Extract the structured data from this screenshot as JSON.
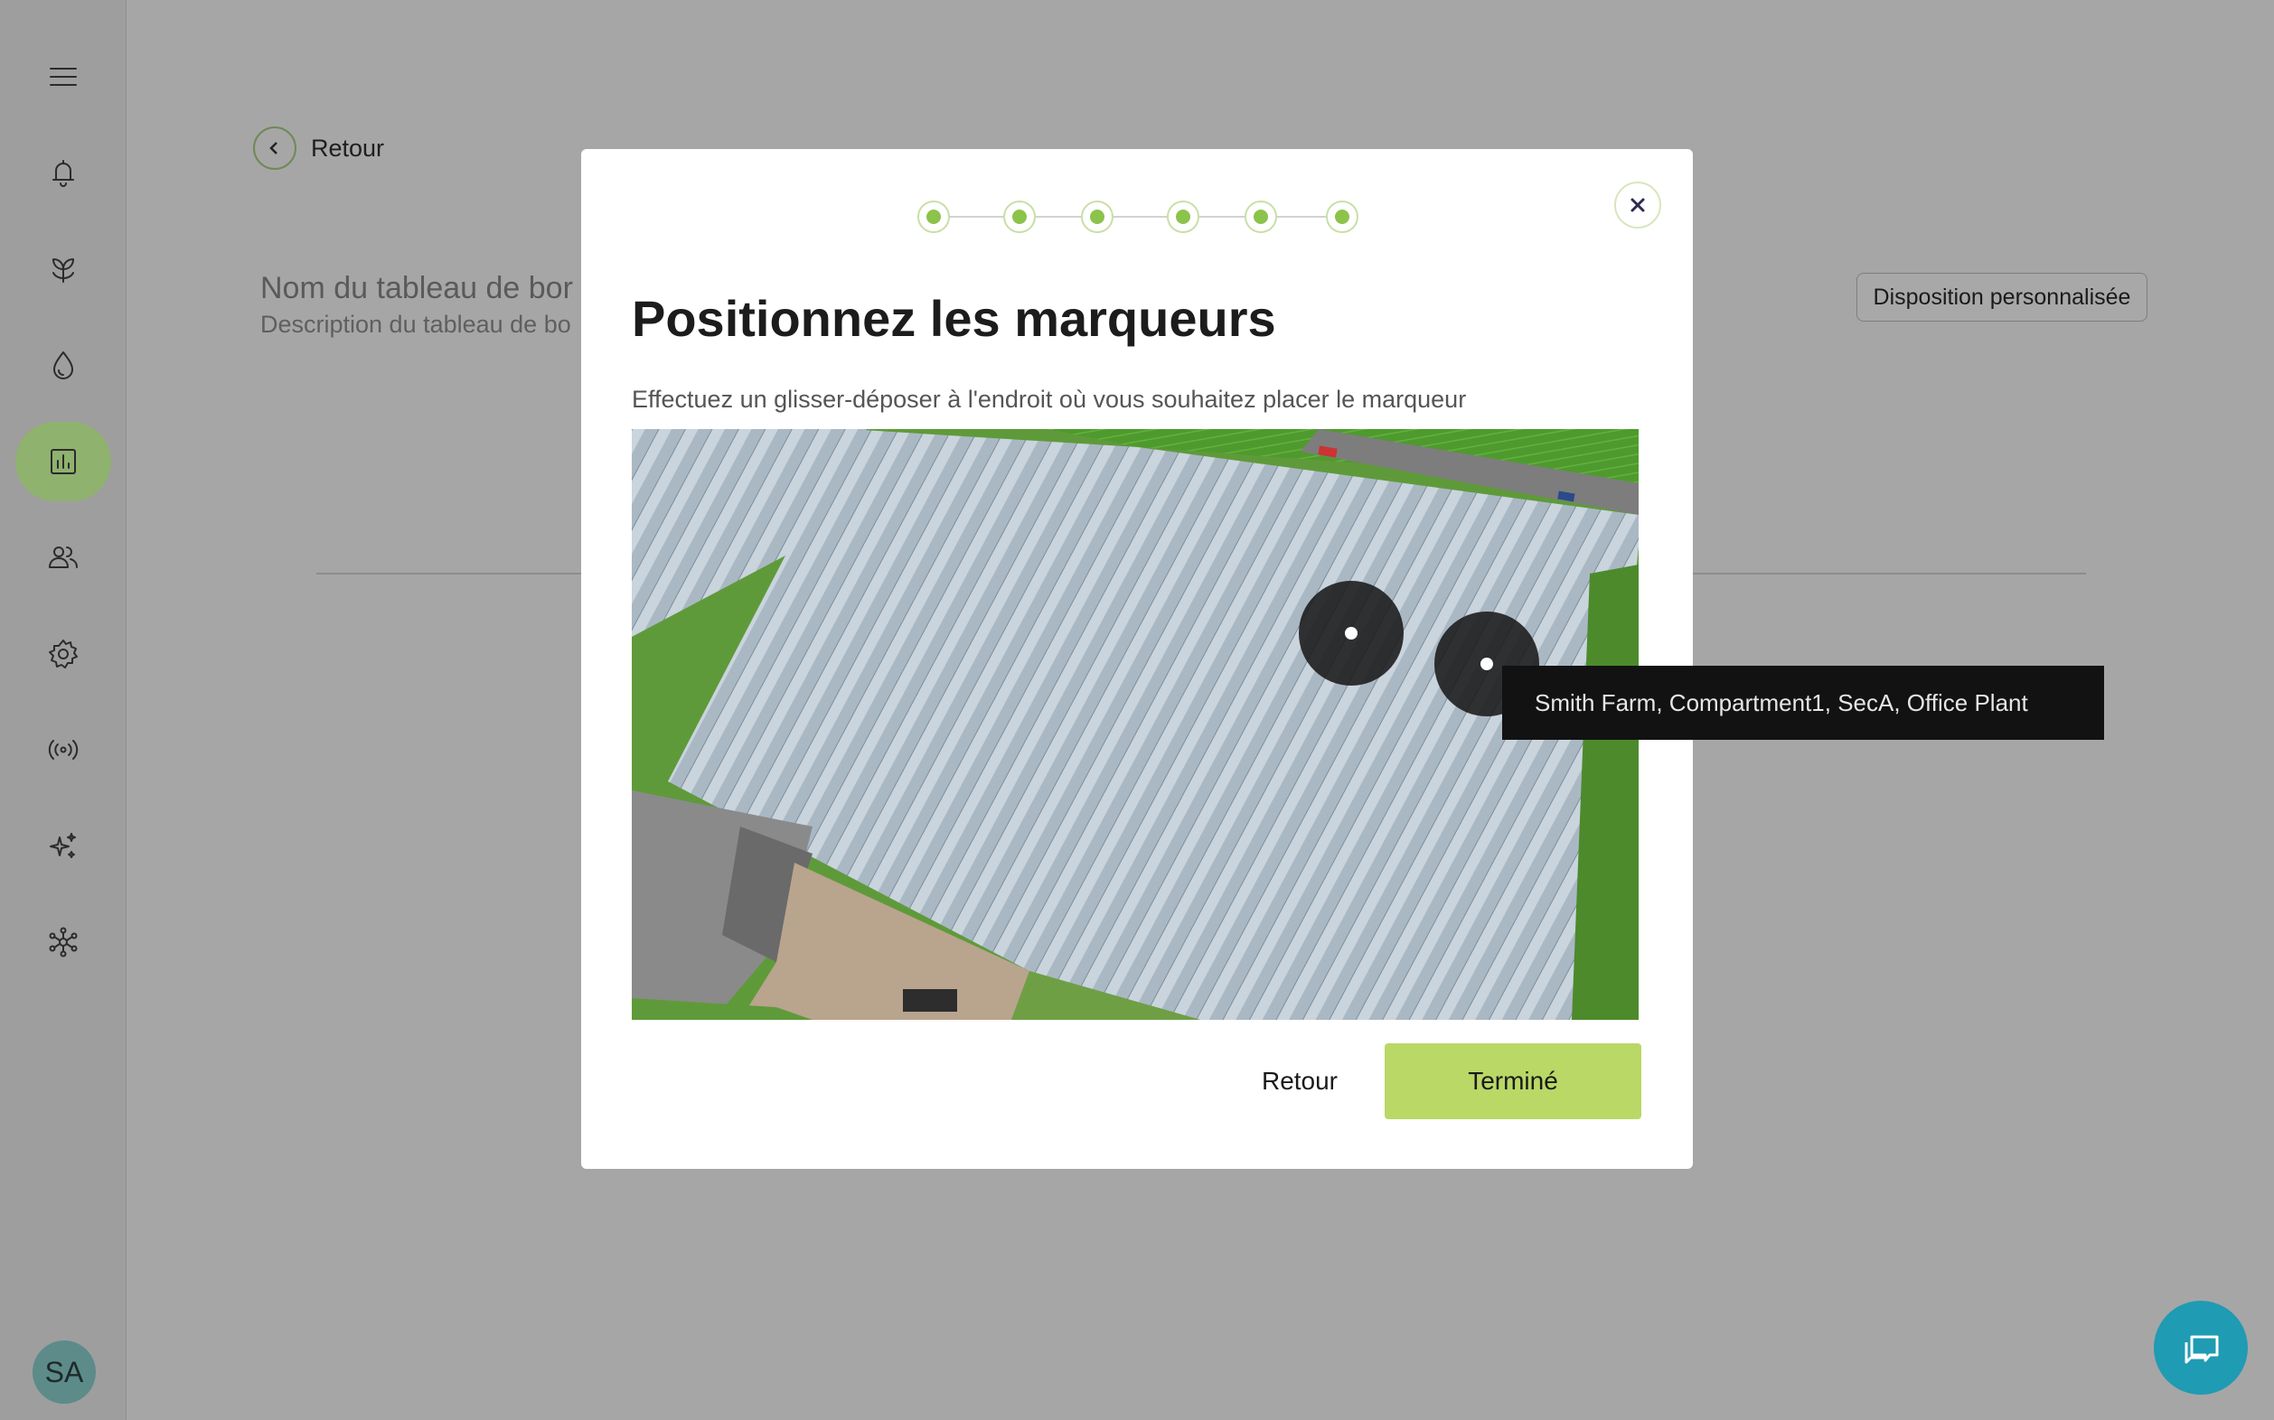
{
  "sidebar": {
    "items": [
      {
        "icon": "menu-icon"
      },
      {
        "icon": "bell-icon"
      },
      {
        "icon": "plant-icon"
      },
      {
        "icon": "water-drop-icon"
      },
      {
        "icon": "dashboard-chart-icon",
        "active": true
      },
      {
        "icon": "users-icon"
      },
      {
        "icon": "gear-icon"
      },
      {
        "icon": "broadcast-icon"
      },
      {
        "icon": "sparkles-icon"
      },
      {
        "icon": "network-icon"
      }
    ],
    "avatar_initials": "SA",
    "accent_color": "#8fb26e"
  },
  "page": {
    "back_label": "Retour",
    "dashboard_name": "Nom du tableau de bor",
    "dashboard_description": "Description du tableau de bo",
    "layout_button": "Disposition personnalisée"
  },
  "modal": {
    "steps_count": 6,
    "title": "Positionnez les marqueurs",
    "subtitle": "Effectuez un glisser-déposer à l'endroit où vous souhaitez placer le marqueur",
    "back_button": "Retour",
    "done_button": "Terminé",
    "done_color": "#b9d866",
    "step_color": "#8cc34a"
  },
  "tooltip": {
    "text": "Smith Farm, Compartment1, SecA, Office Plant"
  },
  "chat": {
    "icon": "chat-icon",
    "color": "#1f9bb3"
  }
}
